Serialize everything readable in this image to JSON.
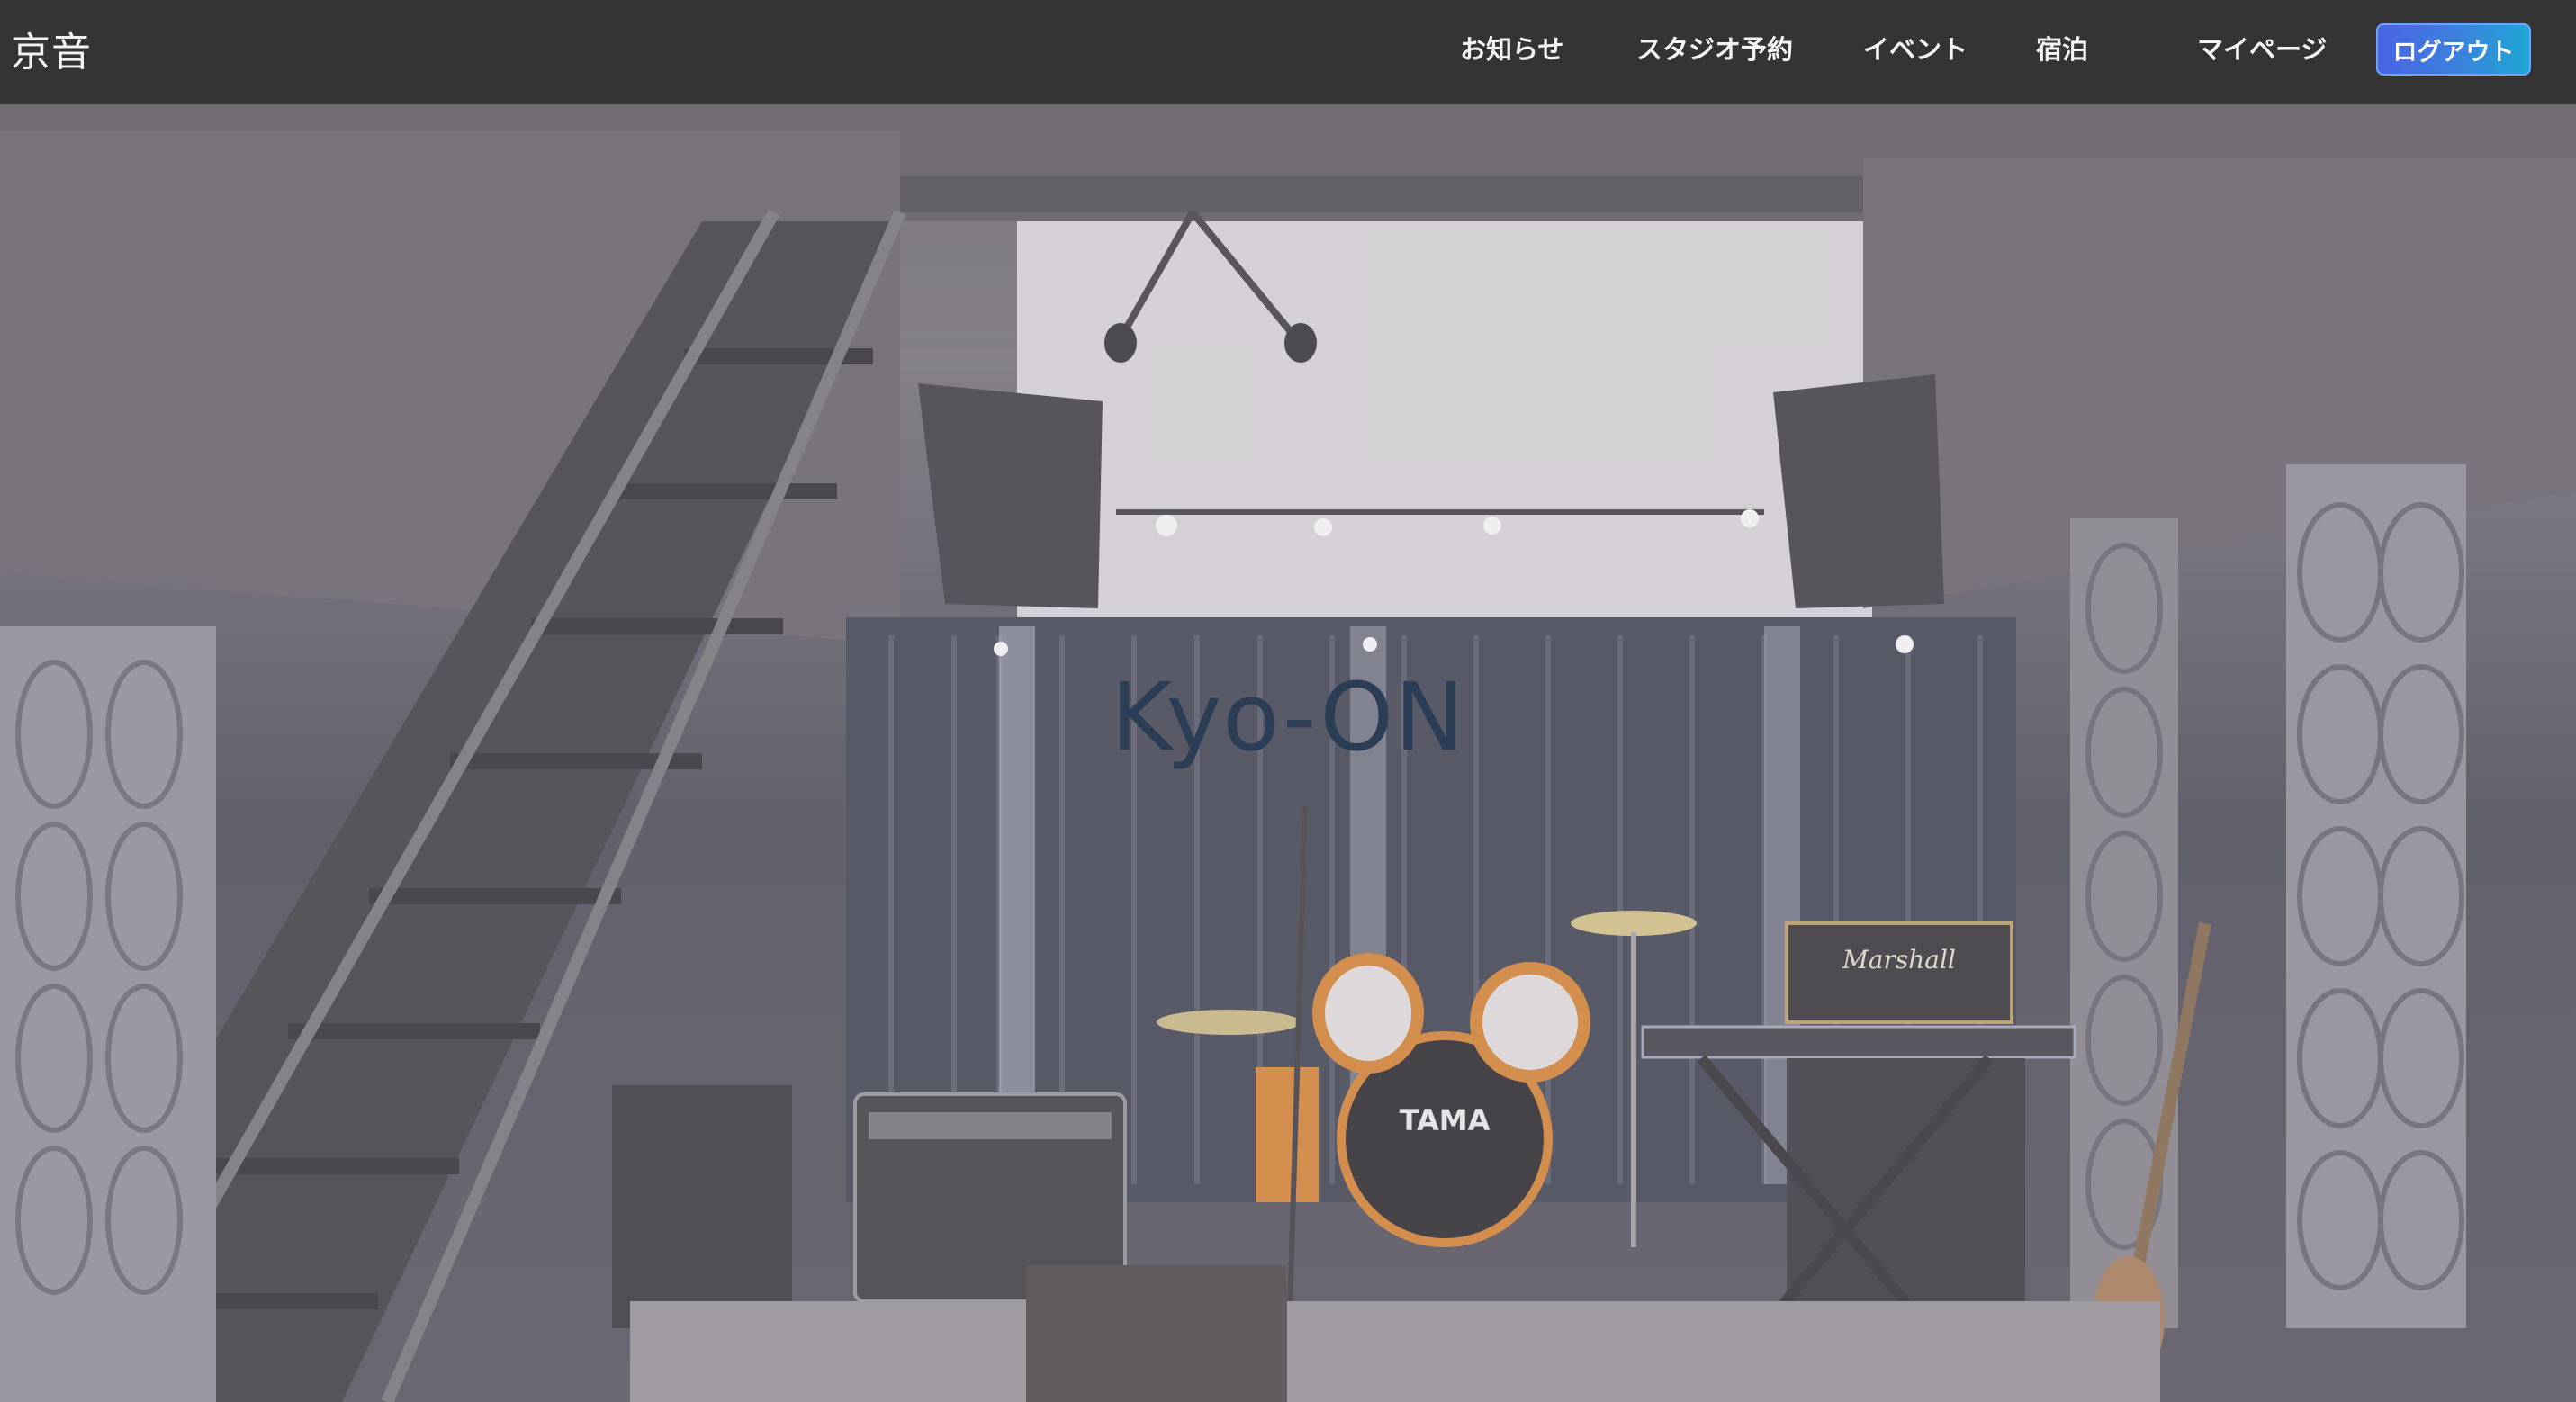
{
  "navbar": {
    "brand": "京音",
    "items": [
      {
        "label": "お知らせ"
      },
      {
        "label": "スタジオ予約"
      },
      {
        "label": "イベント"
      },
      {
        "label": "宿泊"
      },
      {
        "label": "マイページ"
      }
    ],
    "logout_label": "ログアウト"
  },
  "hero": {
    "title": "Kyo-ON",
    "image_subject": "music-studio-stage-photo",
    "drum_brand": "TAMA",
    "amp_brand": "Marshall"
  },
  "colors": {
    "navbar_bg": "#343434",
    "logout_gradient_start": "#4b63e6",
    "logout_gradient_end": "#1ea7d4",
    "hero_title": "#2c3e55"
  }
}
